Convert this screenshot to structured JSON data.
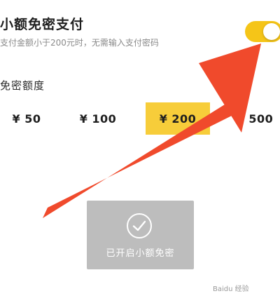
{
  "header": {
    "title": "小额免密支付",
    "subtitle": "支付金额小于200元时，无需输入支付密码",
    "toggle_on": true
  },
  "amount_section": {
    "label": "免密额度",
    "options": [
      "¥ 50",
      "¥ 100",
      "¥ 200",
      "¥ 500"
    ],
    "selected_index": 2
  },
  "confirmation": {
    "text": "已开启小额免密",
    "icon": "check-circle-icon"
  },
  "overlay": {
    "arrow_color": "#f04a2c",
    "watermark": "Baidu 经验"
  },
  "colors": {
    "accent": "#f5c518",
    "selected_bg": "#f7cd3a",
    "confirm_bg": "#bdbdbd"
  }
}
